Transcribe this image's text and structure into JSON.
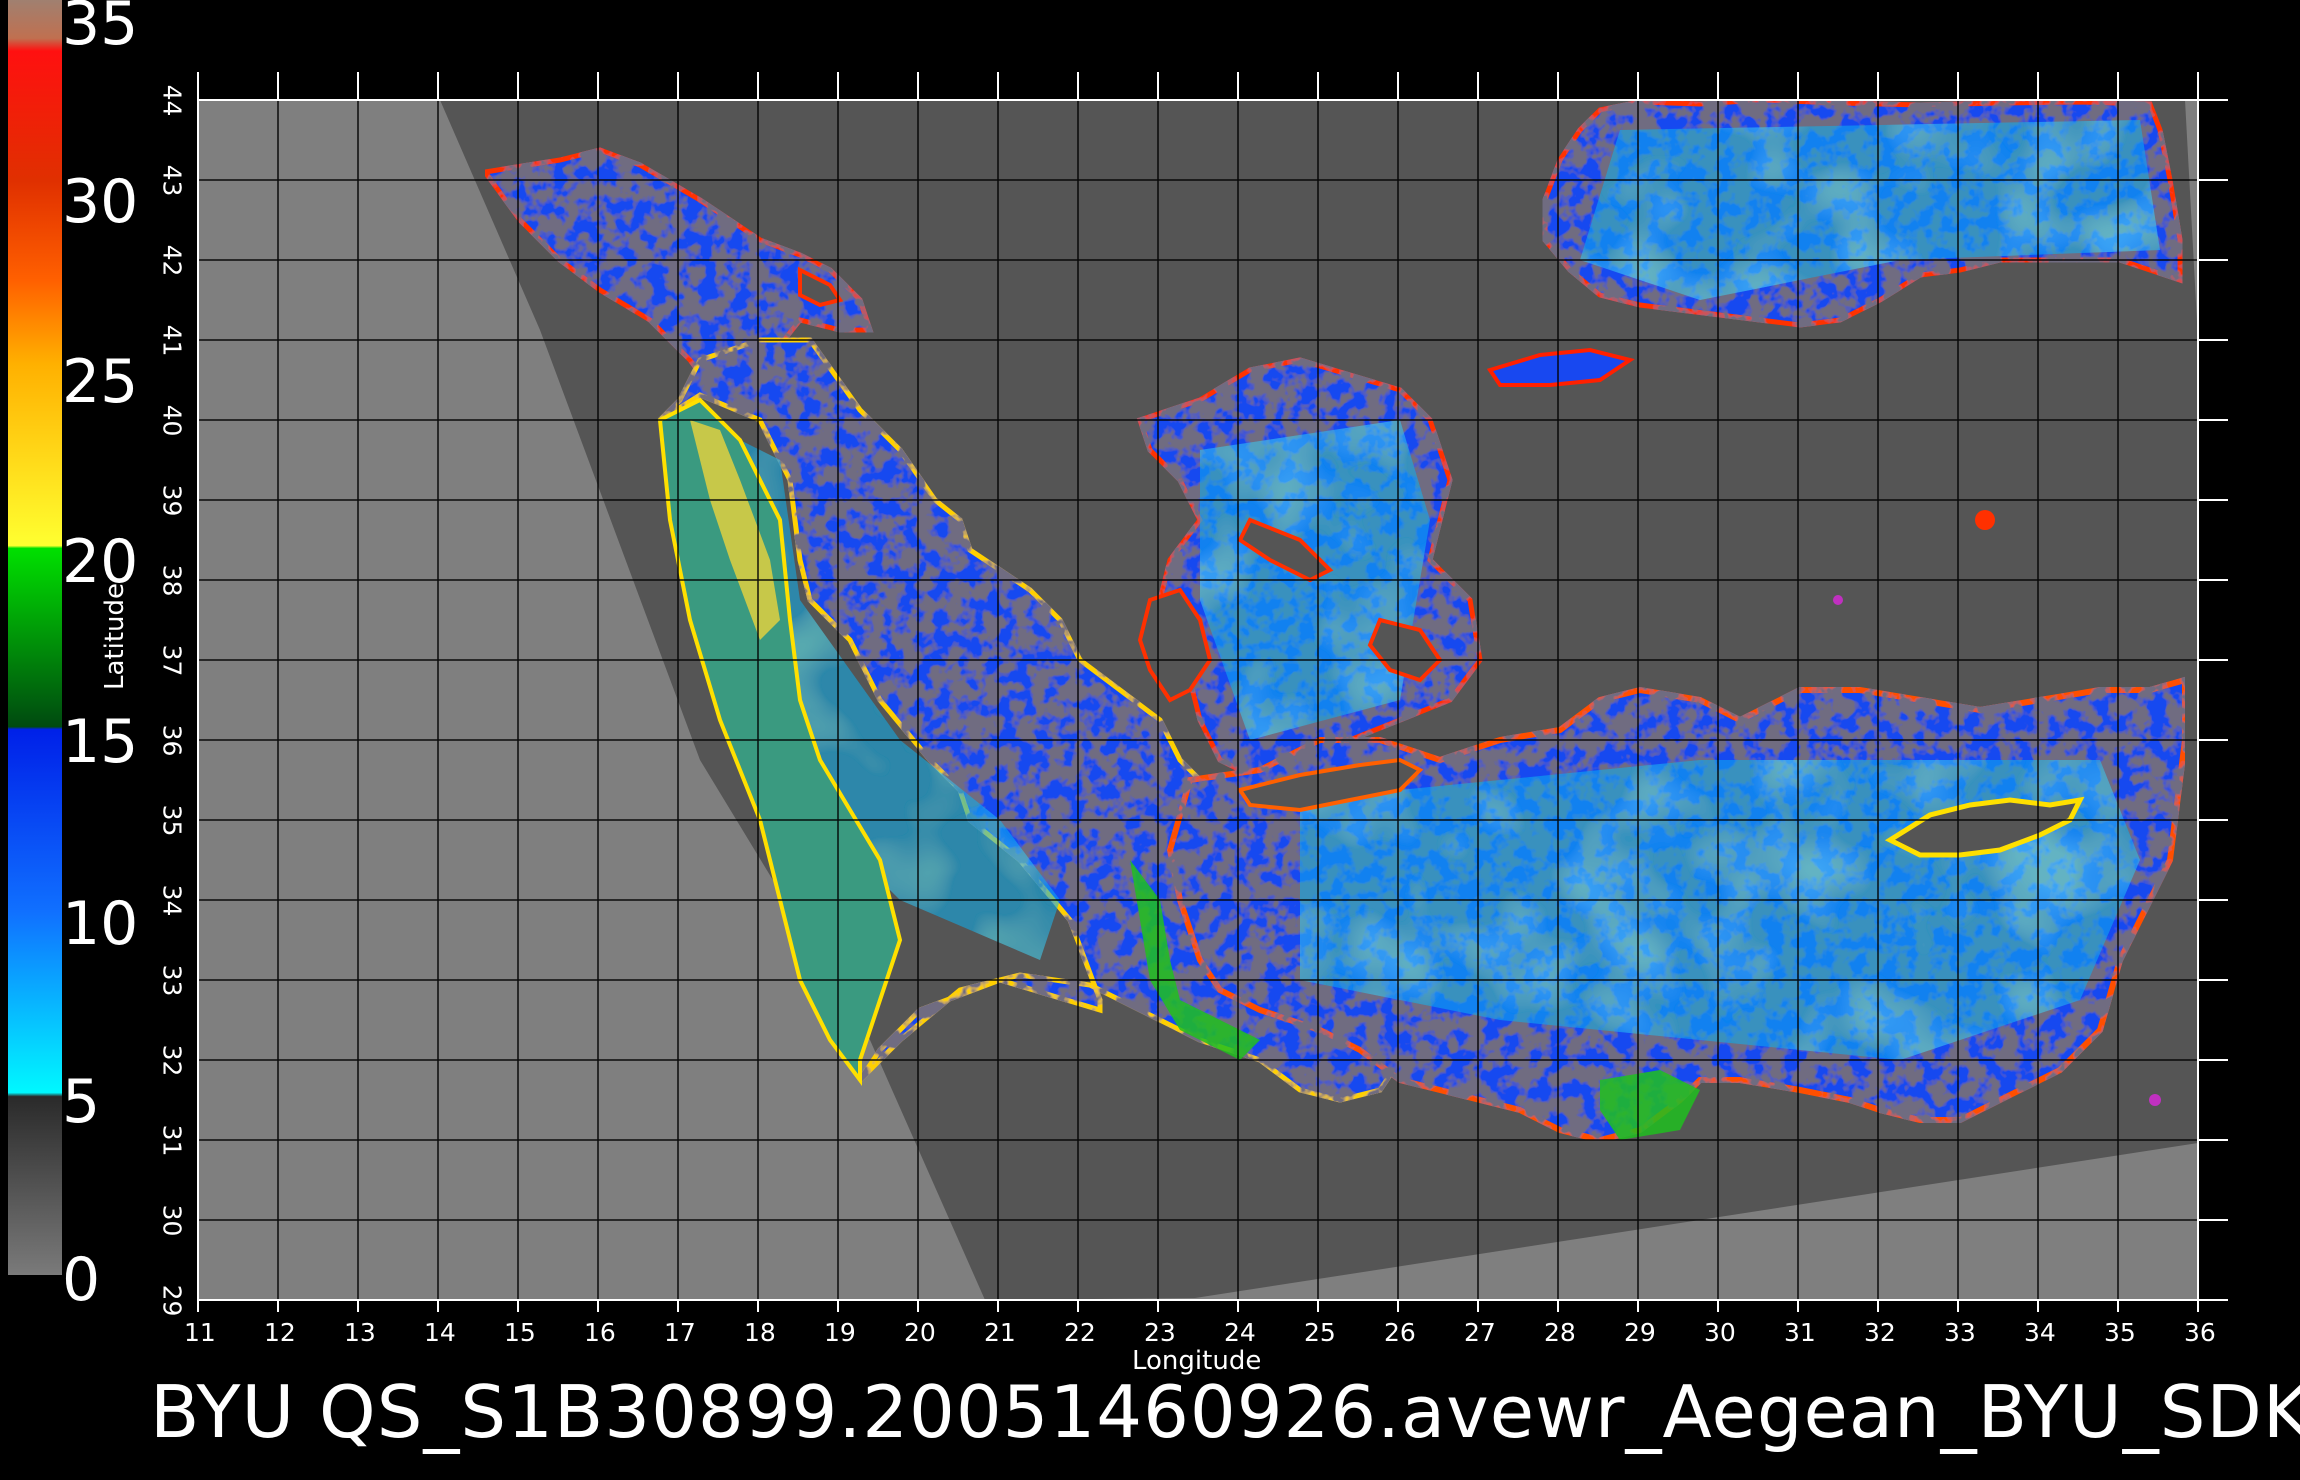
{
  "title": "BYU  QS_S1B30899.20051460926.avewr_Aegean_BYU_SDK",
  "axes": {
    "x_title": "Longitude",
    "y_title": "Latitude",
    "lon_ticks": [
      "11",
      "12",
      "13",
      "14",
      "15",
      "16",
      "17",
      "18",
      "19",
      "20",
      "21",
      "22",
      "23",
      "24",
      "25",
      "26",
      "27",
      "28",
      "29",
      "30",
      "31",
      "32",
      "33",
      "34",
      "35",
      "36"
    ],
    "lat_ticks": [
      "29",
      "30",
      "31",
      "32",
      "33",
      "34",
      "35",
      "36",
      "37",
      "38",
      "39",
      "40",
      "41",
      "42",
      "43",
      "44"
    ]
  },
  "colorbar": {
    "labels": [
      "0",
      "5",
      "10",
      "15",
      "20",
      "25",
      "30",
      "35"
    ],
    "colors": {
      "gray_low": "#777777",
      "gray_high": "#2a2a2a",
      "cyan": "#00f0ff",
      "blue": "#0040ff",
      "green_dark": "#007a10",
      "green": "#00e000",
      "yellow": "#ffff20",
      "orange": "#ff9a00",
      "red": "#ff2000",
      "top": "#b87850"
    }
  },
  "map_colors": {
    "outside_swath": "#7f7f7f",
    "land_in_swath": "#555555",
    "sea_blue": "#1040f0",
    "sea_cyan": "#18d0f0",
    "coast_red": "#ff2000",
    "coast_yellow": "#ffe000",
    "coast_green": "#20e020",
    "dark_patch": "#404050",
    "grid": "#000000"
  }
}
